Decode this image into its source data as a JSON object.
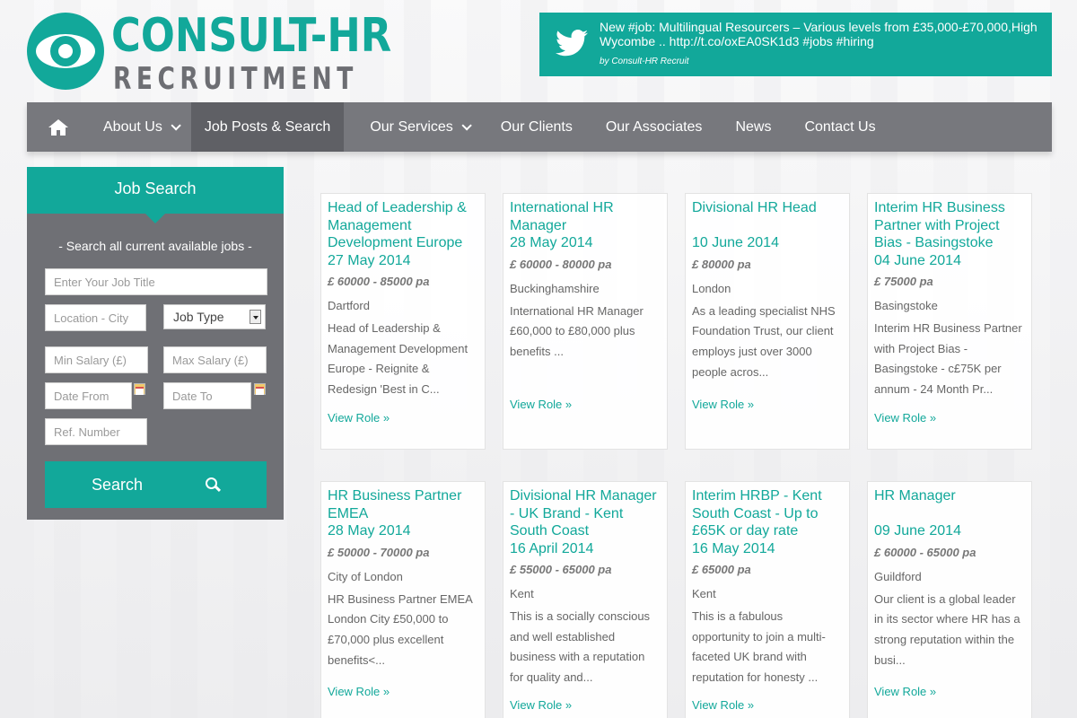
{
  "logo": {
    "title": "CONSULT-HR",
    "subtitle": "RECRUITMENT"
  },
  "tweet": {
    "text": "New #job: Multilingual Resourcers – Various levels from £35,000-£70,000,High Wycombe .. http://t.co/oxEA0SK1d3 #jobs #hiring",
    "author": "by Consult-HR Recruit"
  },
  "nav": {
    "items": [
      {
        "label": "About Us",
        "dropdown": true
      },
      {
        "label": "Job Posts & Search",
        "active": true
      },
      {
        "label": "Our Services",
        "dropdown": true
      },
      {
        "label": "Our Clients"
      },
      {
        "label": "Our Associates"
      },
      {
        "label": "News"
      },
      {
        "label": "Contact Us"
      }
    ]
  },
  "job_search": {
    "heading": "Job Search",
    "description": "- Search all current available jobs -",
    "job_title_placeholder": "Enter Your Job Title",
    "location_placeholder": "Location - City",
    "job_type": "Job Type",
    "min_salary_placeholder": "Min Salary (£)",
    "max_salary_placeholder": "Max Salary (£)",
    "date_from_placeholder": "Date From",
    "date_to_placeholder": "Date To",
    "ref_placeholder": "Ref. Number",
    "search_label": "Search"
  },
  "jobs": [
    {
      "title": "Head of Leadership & Management Development Europe",
      "date": "27 May 2014",
      "salary": "£ 60000 - 85000 pa",
      "location": "Dartford",
      "description": "Head of Leadership & Management Development Europe - Reignite & Redesign 'Best in C...",
      "link": "View Role »"
    },
    {
      "title": "International HR Manager",
      "date": "28 May 2014",
      "salary": "£ 60000 - 80000 pa",
      "location": "Buckinghamshire",
      "description": "International HR Manager £60,000 to £80,000 plus benefits ...",
      "link": "View Role »"
    },
    {
      "title": "Divisional HR Head",
      "date": "10 June 2014",
      "salary": "£ 80000 pa",
      "location": "London",
      "description": "As a leading specialist NHS Foundation Trust, our client employs just over 3000 people acros...",
      "link": "View Role »"
    },
    {
      "title": "Interim HR Business Partner with Project Bias - Basingstoke",
      "date": "04 June 2014",
      "salary": "£ 75000 pa",
      "location": "Basingstoke",
      "description": "Interim HR Business Partner with Project Bias - Basingstoke - c£75K per annum - 24 Month Pr...",
      "link": "View Role »"
    },
    {
      "title": "HR Business Partner EMEA",
      "date": "28 May 2014",
      "salary": "£ 50000 - 70000 pa",
      "location": "City of London",
      "description": "HR Business Partner EMEA London City £50,000 to £70,000 plus excellent benefits<...",
      "link": "View Role »"
    },
    {
      "title": "Divisional HR Manager - UK Brand - Kent South Coast",
      "date": "16 April 2014",
      "salary": "£ 55000 - 65000 pa",
      "location": "Kent",
      "description": "This is a socially conscious and well established business with a reputation for quality and...",
      "link": "View Role »"
    },
    {
      "title": "Interim HRBP - Kent South Coast - Up to £65K or day rate",
      "date": "16 May 2014",
      "salary": "£ 65000 pa",
      "location": "Kent",
      "description": "This is a fabulous opportunity to join a multi-faceted UK brand with reputation for honesty ...",
      "link": "View Role »"
    },
    {
      "title": "HR Manager",
      "date": "09 June 2014",
      "salary": "£ 60000 - 65000 pa",
      "location": "Guildford",
      "description": "Our client is a global leader in its sector where HR has a strong reputation within the busi...",
      "link": "View Role »"
    }
  ],
  "colors": {
    "accent": "#12a89a",
    "nav": "#77787d",
    "nav_active": "#5f6065",
    "panel": "#6f7075"
  }
}
